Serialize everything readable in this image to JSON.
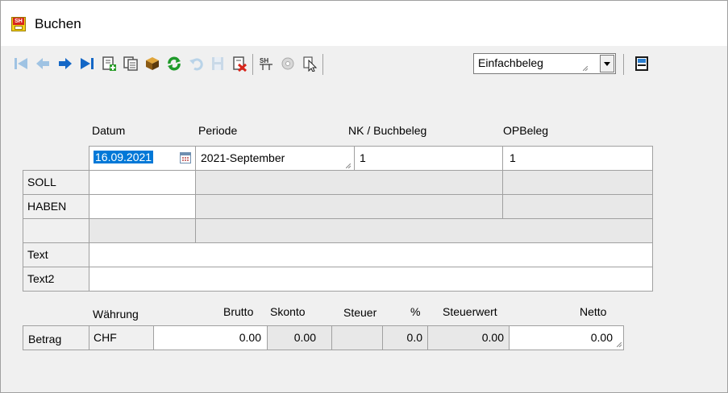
{
  "window": {
    "title": "Buchen",
    "icon": "app-logo-icon"
  },
  "toolbar": {
    "buttons": [
      {
        "icon": "first-record-icon"
      },
      {
        "icon": "previous-record-icon"
      },
      {
        "icon": "next-record-icon"
      },
      {
        "icon": "last-record-icon"
      },
      {
        "icon": "new-record-icon"
      },
      {
        "icon": "copy-record-icon"
      },
      {
        "icon": "package-icon"
      },
      {
        "icon": "refresh-icon"
      },
      {
        "icon": "undo-icon"
      },
      {
        "icon": "save-icon"
      },
      {
        "icon": "delete-icon"
      },
      {
        "icon": "logo-toolbar-icon"
      },
      {
        "icon": "disc-icon"
      },
      {
        "icon": "pointer-document-icon"
      },
      {
        "icon": "layout-icon"
      }
    ],
    "logo_text": "SH",
    "beleg_select": {
      "value": "Einfachbeleg"
    }
  },
  "form": {
    "headers": {
      "datum": "Datum",
      "periode": "Periode",
      "nk_buchbeleg": "NK / Buchbeleg",
      "opbeleg": "OPBeleg"
    },
    "datum_value": "16.09.2021",
    "periode_value": "2021-September",
    "nk_value": "1",
    "opbeleg_value": "1",
    "rows": {
      "soll": "SOLL",
      "haben": "HABEN",
      "text": "Text",
      "text2": "Text2"
    },
    "text_value": "",
    "text2_value": ""
  },
  "betrag": {
    "headers": {
      "waehrung": "Währung",
      "brutto": "Brutto",
      "skonto": "Skonto",
      "steuer": "Steuer",
      "percent": "%",
      "steuerwert": "Steuerwert",
      "netto": "Netto"
    },
    "row_label": "Betrag",
    "currency": "CHF",
    "brutto": "0.00",
    "skonto": "0.00",
    "steuer": "",
    "percent": "0.0",
    "steuerwert": "0.00",
    "netto": "0.00"
  },
  "colors": {
    "selection": "#0078d7",
    "window_bg": "#f0f0f0"
  }
}
